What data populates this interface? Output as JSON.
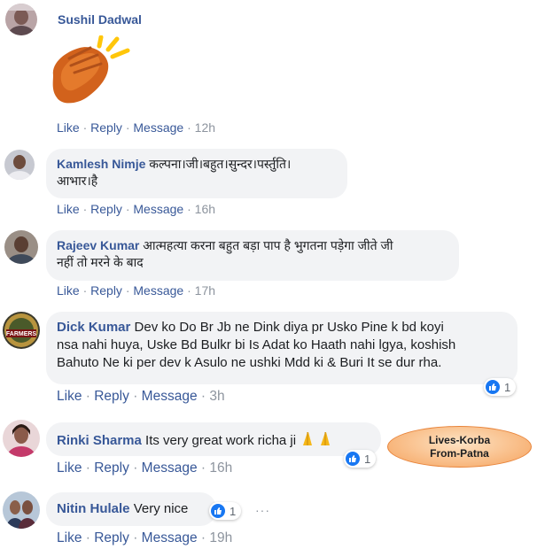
{
  "comments": [
    {
      "name": "Sushil Dadwal",
      "text": "",
      "time": "12h",
      "reaction_count": ""
    },
    {
      "name": "Kamlesh Nimje",
      "text": "कल्पना।जी।बहुत।सुन्दर।पर्स्तुति।\nआभार।है",
      "time": "16h",
      "reaction_count": ""
    },
    {
      "name": "Rajeev Kumar",
      "text": "आत्महत्या करना बहुत बड़ा पाप है भुगतना पड़ेगा जीते जी\nनहीं तो मरने के बाद",
      "time": "17h",
      "reaction_count": ""
    },
    {
      "name": "Dick Kumar",
      "text": "Dev ko Do Br Jb ne Dink diya pr Usko Pine k bd koyi\nnsa nahi huya, Uske Bd Bulkr bi Is Adat ko Haath nahi lgya, koshish\nBahuto Ne ki per dev k Asulo ne ushki Mdd ki & Buri It se dur rha.",
      "time": "3h",
      "reaction_count": "1"
    },
    {
      "name": "Rinki Sharma",
      "text": "Its very great work richa ji",
      "time": "16h",
      "reaction_count": "1"
    },
    {
      "name": "Nitin Hulale",
      "text": "Very nice",
      "time": "19h",
      "reaction_count": "1"
    }
  ],
  "actions": {
    "like": "Like",
    "reply": "Reply",
    "message": "Message",
    "sep": "·"
  },
  "avatar_badge_text": "FARMERS",
  "overlay_note": {
    "line1": "Lives-Korba",
    "line2": "From-Patna"
  },
  "more_icon": "···",
  "icons": {
    "clap": "clapping-hands-emoji",
    "pray": "folded-hands-emoji",
    "like": "thumbs-up-icon"
  },
  "colors": {
    "name": "#385898",
    "meta": "#8d949e",
    "bubble": "#f2f3f5",
    "like": "#1877f2",
    "note": "#f8b67c"
  }
}
